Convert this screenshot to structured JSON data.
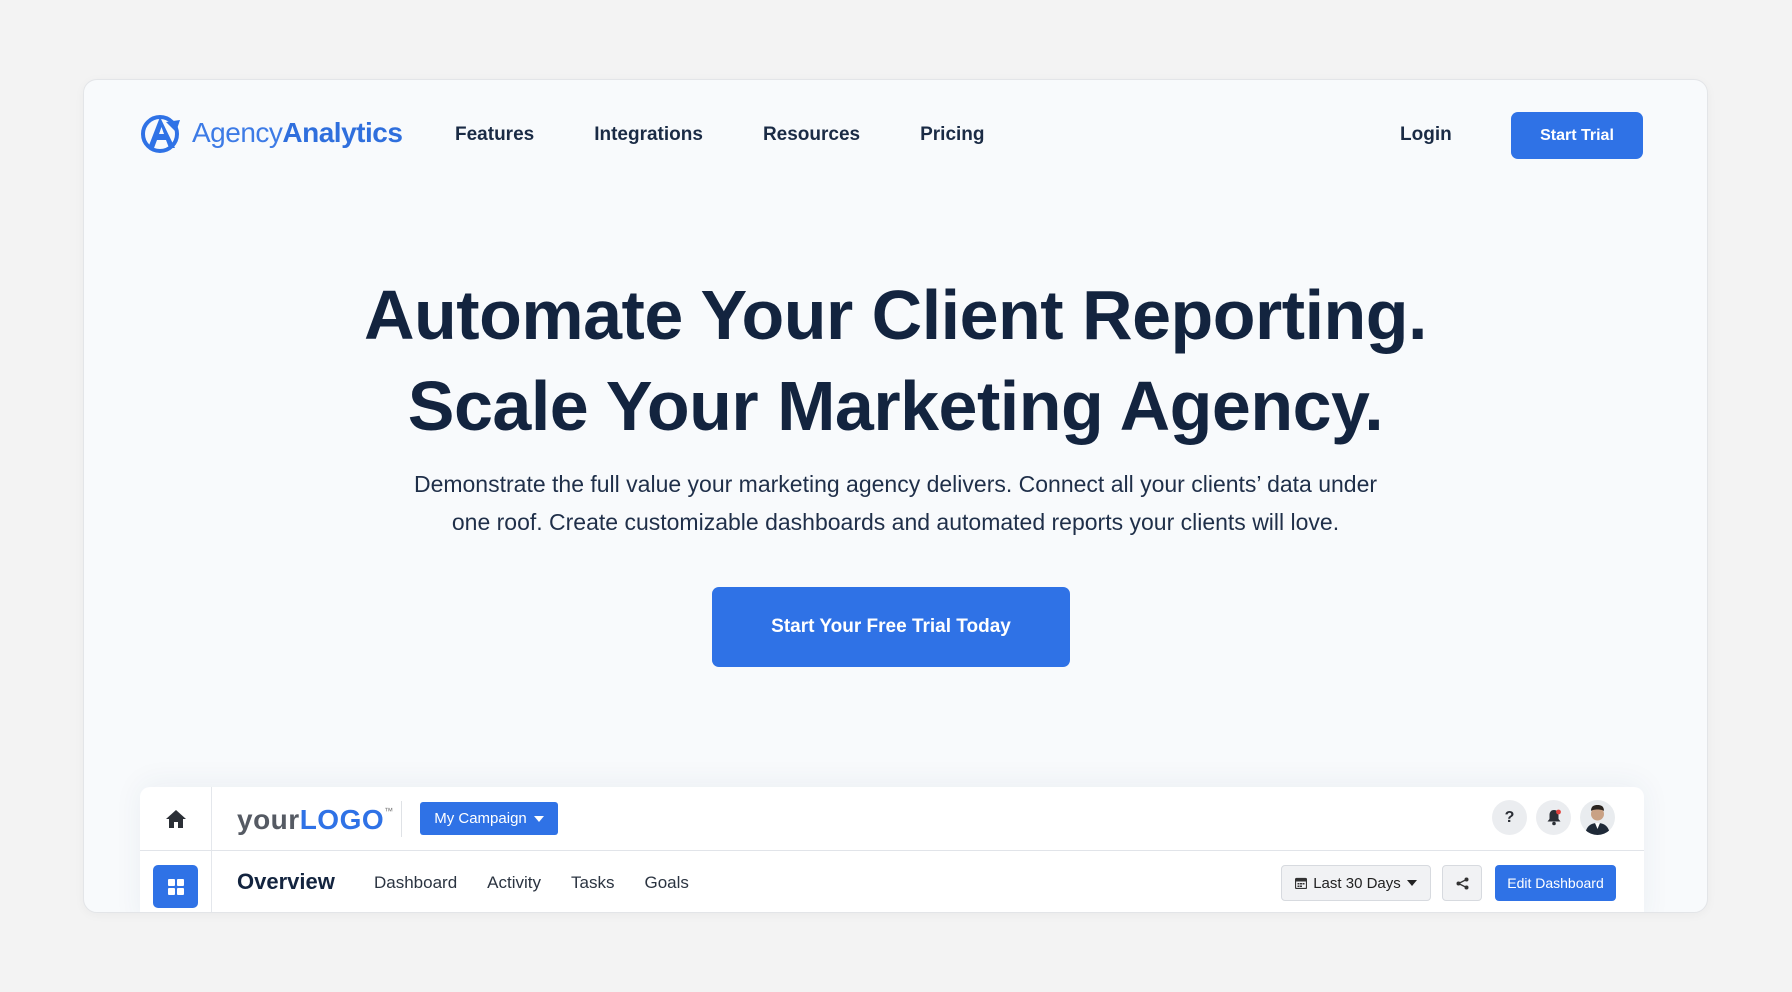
{
  "brand": {
    "name_light": "Agency",
    "name_bold": "Analytics",
    "color": "#2f72e6",
    "logo_icon": "agencyanalytics-logo-icon"
  },
  "nav": {
    "links": [
      "Features",
      "Integrations",
      "Resources",
      "Pricing"
    ],
    "login": "Login",
    "start_trial": "Start Trial"
  },
  "hero": {
    "title_line1": "Automate Your Client Reporting.",
    "title_line2": "Scale Your Marketing Agency.",
    "subtitle_line1": "Demonstrate the full value your marketing agency delivers. Connect all your clients’ data under",
    "subtitle_line2": "one roof. Create customizable dashboards and automated reports your clients will love.",
    "cta": "Start Your Free Trial Today"
  },
  "dashboard_preview": {
    "logo_your": "your",
    "logo_logo": "LOGO",
    "logo_tm": "™",
    "campaign": "My Campaign",
    "help": "?",
    "page_title": "Overview",
    "tabs": [
      "Dashboard",
      "Activity",
      "Tasks",
      "Goals"
    ],
    "date_range": "Last 30 Days",
    "edit": "Edit Dashboard",
    "icons": [
      "home-icon",
      "grid-icon",
      "help-icon",
      "bell-icon",
      "avatar",
      "calendar-icon",
      "share-icon"
    ]
  }
}
